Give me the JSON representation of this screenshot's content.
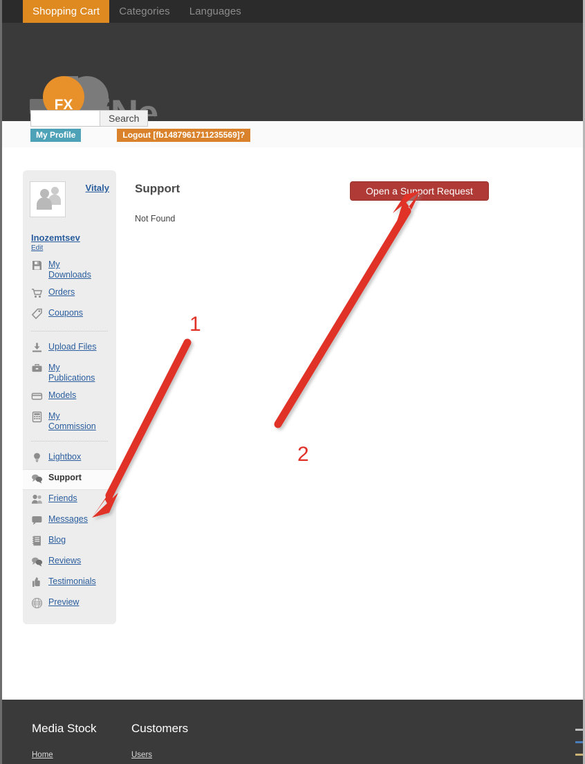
{
  "topnav": {
    "items": [
      {
        "label": "Shopping Cart",
        "active": true
      },
      {
        "label": "Categories",
        "active": false
      },
      {
        "label": "Languages",
        "active": false
      }
    ]
  },
  "header": {
    "logo": {
      "badge_text": "FX",
      "word": "LiNe",
      "badge_color": "#e8902a",
      "letter_color": "#7b7b7b"
    },
    "search": {
      "value": "",
      "placeholder": "",
      "button_label": "Search"
    },
    "auth": {
      "profile_label": "My Profile",
      "logout_label": "Logout [fb1487961711235569]?",
      "profile_color": "#4da2b8",
      "logout_color": "#d9822b"
    }
  },
  "sidebar": {
    "user": {
      "first_name": "Vitaly",
      "last_name": "Inozemtsev",
      "edit_label": "Edit",
      "avatar_icon": "users-avatar-icon"
    },
    "groups": [
      {
        "items": [
          {
            "label": "My Downloads",
            "icon": "floppy-disk-icon",
            "active": false
          },
          {
            "label": "Orders",
            "icon": "shopping-cart-icon",
            "active": false
          },
          {
            "label": "Coupons",
            "icon": "tag-icon",
            "active": false
          }
        ]
      },
      {
        "items": [
          {
            "label": "Upload Files",
            "icon": "upload-icon",
            "active": false
          },
          {
            "label": "My Publications",
            "icon": "briefcase-icon",
            "active": false
          },
          {
            "label": "Models",
            "icon": "card-icon",
            "active": false
          },
          {
            "label": "My Commission",
            "icon": "calculator-icon",
            "active": false
          }
        ]
      },
      {
        "items": [
          {
            "label": "Lightbox",
            "icon": "lightbulb-icon",
            "active": false
          },
          {
            "label": "Support",
            "icon": "speech-bubbles-icon",
            "active": true
          },
          {
            "label": "Friends",
            "icon": "friends-icon",
            "active": false
          },
          {
            "label": "Messages",
            "icon": "message-icon",
            "active": false
          },
          {
            "label": "Blog",
            "icon": "notebook-icon",
            "active": false
          },
          {
            "label": "Reviews",
            "icon": "speech-bubbles-icon",
            "active": false
          },
          {
            "label": "Testimonials",
            "icon": "thumbs-up-icon",
            "active": false
          },
          {
            "label": "Preview",
            "icon": "globe-icon",
            "active": false
          }
        ]
      }
    ]
  },
  "main": {
    "title": "Support",
    "body_text": "Not Found",
    "support_button_label": "Open a Support Request",
    "support_button_color": "#b03a36"
  },
  "footer": {
    "columns": [
      {
        "heading": "Media Stock",
        "links": [
          "Home"
        ]
      },
      {
        "heading": "Customers",
        "links": [
          "Users"
        ]
      }
    ]
  },
  "annotations": {
    "accent_color": "#e03127",
    "markers": [
      {
        "number": "1",
        "target": "sidebar-item-support"
      },
      {
        "number": "2",
        "target": "open-support-request-button"
      }
    ]
  }
}
